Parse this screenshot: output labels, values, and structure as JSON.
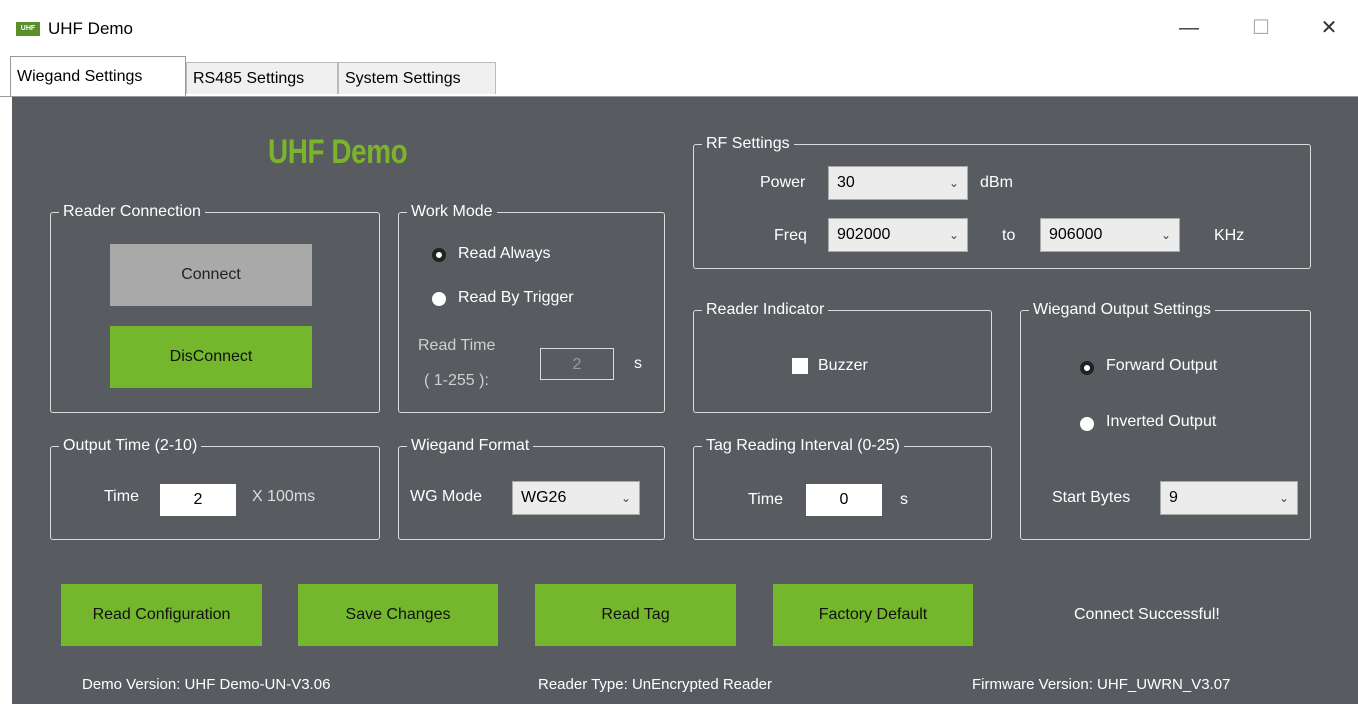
{
  "window": {
    "title": "UHF Demo",
    "icon_label": "UHF",
    "minimize": "—",
    "maximize": "☐",
    "close": "✕"
  },
  "tabs": [
    {
      "label": "Wiegand Settings",
      "active": true
    },
    {
      "label": "RS485 Settings",
      "active": false
    },
    {
      "label": "System Settings",
      "active": false
    }
  ],
  "brand": {
    "text": "UHF Demo",
    "color": "#7bb42a"
  },
  "reader_connection": {
    "label": "Reader Connection",
    "connect": "Connect",
    "disconnect": "DisConnect"
  },
  "work_mode": {
    "label": "Work Mode",
    "option_read_always": "Read Always",
    "option_read_by_trigger": "Read By Trigger",
    "selected": "Read Always",
    "read_time_label_1": "Read Time",
    "read_time_label_2": "( 1-255 ):",
    "read_time_value": "2",
    "read_time_unit": "s"
  },
  "output_time": {
    "label": "Output Time (2-10)",
    "time_label": "Time",
    "value": "2",
    "unit": "X 100ms"
  },
  "wiegand_format": {
    "label": "Wiegand Format",
    "mode_label": "WG Mode",
    "mode_value": "WG26"
  },
  "rf_settings": {
    "label": "RF Settings",
    "power_label": "Power",
    "power_value": "30",
    "power_unit": "dBm",
    "freq_label": "Freq",
    "freq_from": "902000",
    "to_label": "to",
    "freq_to": "906000",
    "freq_unit": "KHz"
  },
  "reader_indicator": {
    "label": "Reader Indicator",
    "buzzer_label": "Buzzer",
    "buzzer_checked": false
  },
  "tag_interval": {
    "label": "Tag Reading Interval (0-25)",
    "time_label": "Time",
    "value": "0",
    "unit": "s"
  },
  "wiegand_output": {
    "label": "Wiegand Output Settings",
    "option_forward": "Forward Output",
    "option_inverted": "Inverted Output",
    "selected": "Forward Output",
    "start_bytes_label": "Start Bytes",
    "start_bytes_value": "9"
  },
  "actions": {
    "read_config": "Read Configuration",
    "save_changes": "Save Changes",
    "read_tag": "Read Tag",
    "factory_default": "Factory Default"
  },
  "status": "Connect Successful!",
  "footer": {
    "demo_version": "Demo Version:   UHF Demo-UN-V3.06",
    "reader_type": "Reader Type:  UnEncrypted Reader",
    "firmware_version": "Firmware Version:   UHF_UWRN_V3.07"
  },
  "colors": {
    "panel": "#585b5f",
    "accent": "#74b72c",
    "button_gray": "#a9a9a9"
  }
}
